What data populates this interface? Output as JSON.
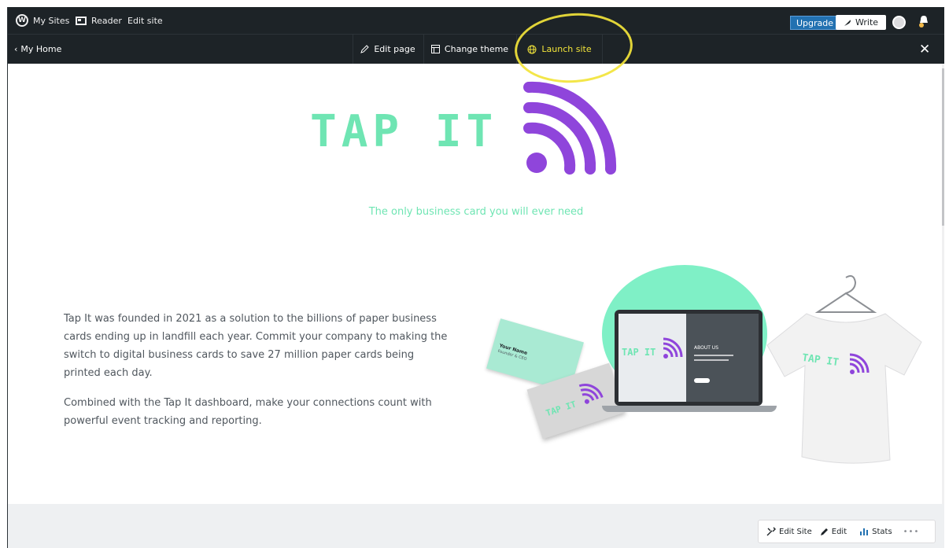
{
  "adminbar": {
    "my_sites": "My Sites",
    "reader": "Reader",
    "edit_site": "Edit site",
    "upgrade": "Upgrade",
    "write": "Write"
  },
  "toolbar": {
    "home": "My Home",
    "edit_page": "Edit page",
    "change_theme": "Change theme",
    "launch_site": "Launch site",
    "close": "✕"
  },
  "site": {
    "logo_text": "TAP IT",
    "tagline": "The only business card you will ever need",
    "paragraph_1": "Tap It was founded in 2021 as a solution to the billions of paper business cards ending up in landfill each year. Commit your company to making the switch to digital business cards to save 27 million paper cards being printed each day.",
    "paragraph_2": "Combined with the Tap It dashboard, make your connections count with powerful event tracking and reporting.",
    "mockup": {
      "card_logo": "TAP IT",
      "card_name": "Your Name",
      "card_title": "Founder & CEO",
      "laptop_logo": "TAP IT",
      "laptop_heading": "ABOUT US",
      "shirt_logo": "TAP IT"
    }
  },
  "floatbar": {
    "edit_site": "Edit Site",
    "edit": "Edit",
    "stats": "Stats",
    "more": "•••"
  },
  "colors": {
    "mint": "#6fe5b3",
    "purple": "#8f45db",
    "admin_bg": "#1d2327",
    "upgrade_blue": "#2271b1",
    "highlight": "#f2e43a"
  }
}
